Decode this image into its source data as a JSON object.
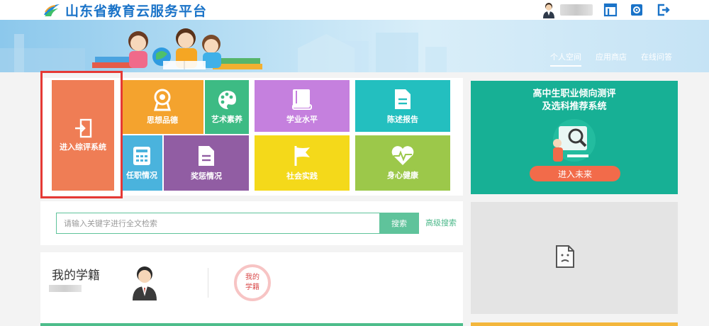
{
  "header": {
    "site_title": "山东省教育云服务平台",
    "top_icons": [
      "layout-icon",
      "settings-icon",
      "logout-icon"
    ]
  },
  "nav": {
    "items": [
      {
        "label": "个人空间",
        "active": true
      },
      {
        "label": "应用商店",
        "active": false
      },
      {
        "label": "在线问答",
        "active": false
      }
    ]
  },
  "tiles": {
    "enter": {
      "label": "进入综评系统",
      "color": "#ef7d55",
      "icon": "door-enter-icon"
    },
    "morality": {
      "label": "思想品德",
      "color": "#f4a32e",
      "icon": "medal-icon"
    },
    "art": {
      "label": "艺术素养",
      "color": "#3dbb84",
      "icon": "palette-icon"
    },
    "academic": {
      "label": "学业水平",
      "color": "#c580de",
      "icon": "book-icon"
    },
    "report": {
      "label": "陈述报告",
      "color": "#23bfbf",
      "icon": "document-icon"
    },
    "duty": {
      "label": "任职情况",
      "color": "#4ab3dd",
      "icon": "calculator-icon"
    },
    "award": {
      "label": "奖惩情况",
      "color": "#915da3",
      "icon": "note-icon"
    },
    "practice": {
      "label": "社会实践",
      "color": "#f4d91a",
      "icon": "flag-icon"
    },
    "health": {
      "label": "身心健康",
      "color": "#9cc84a",
      "icon": "heart-icon"
    }
  },
  "search": {
    "placeholder": "请输入关键字进行全文检索",
    "button_label": "搜索",
    "advanced_label": "高级搜索"
  },
  "record": {
    "title": "我的学籍",
    "badge_line1": "我的",
    "badge_line2": "学籍"
  },
  "promo": {
    "title_line1": "高中生职业倾向测评",
    "title_line2": "及选科推荐系统",
    "button_label": "进入未来"
  },
  "colors": {
    "brand_blue": "#1a73c8",
    "accent_green": "#5fc39b",
    "highlight_red": "#e53935",
    "promo_teal": "#17b095"
  }
}
